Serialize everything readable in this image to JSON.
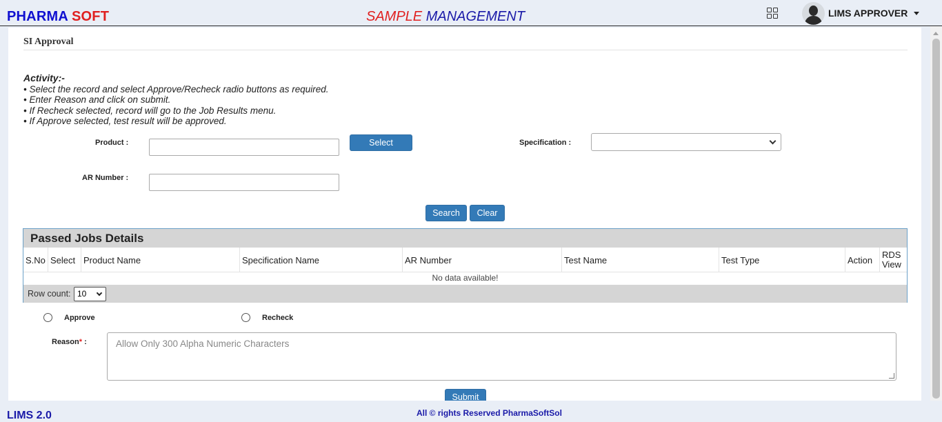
{
  "header": {
    "brand_part1": "PHARMA ",
    "brand_part2": "SOFT",
    "title_part1": "SAMPLE ",
    "title_part2": "MANAGEMENT",
    "user_name": "LIMS APPROVER",
    "icons": [
      "grid-icon",
      "avatar",
      "chevron-down-icon"
    ]
  },
  "page": {
    "title": "SI Approval"
  },
  "activity": {
    "heading": "Activity:-",
    "lines": [
      "• Select the record and select Approve/Recheck radio buttons as required.",
      "• Enter Reason and click on submit.",
      "• If Recheck selected, record will go to the Job Results menu.",
      "• If Approve selected, test result will be approved."
    ]
  },
  "form": {
    "product_label": "Product :",
    "product_value": "",
    "select_button": "Select",
    "specification_label": "Specification :",
    "specification_value": "",
    "ar_number_label": "AR Number :",
    "ar_number_value": "",
    "search_button": "Search",
    "clear_button": "Clear"
  },
  "table": {
    "title": "Passed Jobs Details",
    "columns": [
      "S.No",
      "Select",
      "Product Name",
      "Specification Name",
      "AR Number",
      "Test Name",
      "Test Type",
      "Action",
      "RDS View"
    ],
    "empty_message": "No data available!",
    "row_count_label": "Row count:",
    "row_count_value": "10"
  },
  "decision": {
    "approve_label": "Approve",
    "recheck_label": "Recheck",
    "reason_label": "Reason",
    "reason_required_mark": "*",
    "reason_colon": " :",
    "reason_placeholder": "Allow Only 300 Alpha Numeric Characters",
    "submit_button": "Submit"
  },
  "footer": {
    "version": "LIMS 2.0",
    "copyright": "All © rights Reserved PharmaSoftSol"
  },
  "colors": {
    "brand_blue": "#1010d0",
    "brand_red": "#e02020",
    "button_blue": "#337ab7",
    "panel_grey": "#d5d5d5"
  }
}
